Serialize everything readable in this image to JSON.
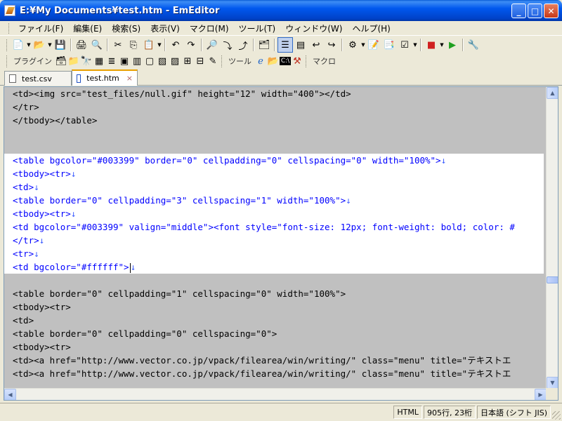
{
  "window": {
    "title": "E:¥My Documents¥test.htm - EmEditor",
    "minimize_glyph": "_",
    "maximize_glyph": "□",
    "close_glyph": "✕"
  },
  "menu": {
    "items": [
      {
        "label": "ファイル(F)"
      },
      {
        "label": "編集(E)"
      },
      {
        "label": "検索(S)"
      },
      {
        "label": "表示(V)"
      },
      {
        "label": "マクロ(M)"
      },
      {
        "label": "ツール(T)"
      },
      {
        "label": "ウィンドウ(W)"
      },
      {
        "label": "ヘルプ(H)"
      }
    ]
  },
  "toolbar2": {
    "plugins_label": "プラグイン",
    "tools_label": "ツール",
    "macro_label": "マクロ"
  },
  "tabs": [
    {
      "label": "test.csv",
      "active": false
    },
    {
      "label": "test.htm",
      "active": true
    },
    {
      "close_glyph": "×"
    }
  ],
  "editor": {
    "lines": [
      "<td><img src=\"test_files/null.gif\" height=\"12\" width=\"400\"></td>",
      "</tr>",
      "</tbody></table>",
      "",
      "",
      "<table bgcolor=\"#003399\" border=\"0\" cellpadding=\"0\" cellspacing=\"0\" width=\"100%\">",
      "<tbody><tr>",
      "<td>",
      "<table border=\"0\" cellpadding=\"3\" cellspacing=\"1\" width=\"100%\">",
      "<tbody><tr>",
      "<td bgcolor=\"#003399\" valign=\"middle\"><font style=\"font-size: 12px; font-weight: bold; color: #",
      "</tr>",
      "<tr>",
      "<td bgcolor=\"#ffffff\">",
      "",
      "<table border=\"0\" cellpadding=\"1\" cellspacing=\"0\" width=\"100%\">",
      "<tbody><tr>",
      "<td>",
      "<table border=\"0\" cellpadding=\"0\" cellspacing=\"0\">",
      "<tbody><tr>",
      "<td><a href=\"http://www.vector.co.jp/vpack/filearea/win/writing/\" class=\"menu\" title=\"テキストエ",
      "<td><a href=\"http://www.vector.co.jp/vpack/filearea/win/writing/\" class=\"menu\" title=\"テキストエ"
    ],
    "newline_glyph": "↓"
  },
  "status": {
    "syntax": "HTML",
    "position": "905行, 23桁",
    "encoding": "日本語 (シフト JIS)"
  },
  "colors": {
    "selection_bg": "#ffffff",
    "unselected_bg": "#c0c0c0",
    "tag": "#0000ff",
    "attribute_value": "#c000c0",
    "titlebar": "#0058ee"
  }
}
